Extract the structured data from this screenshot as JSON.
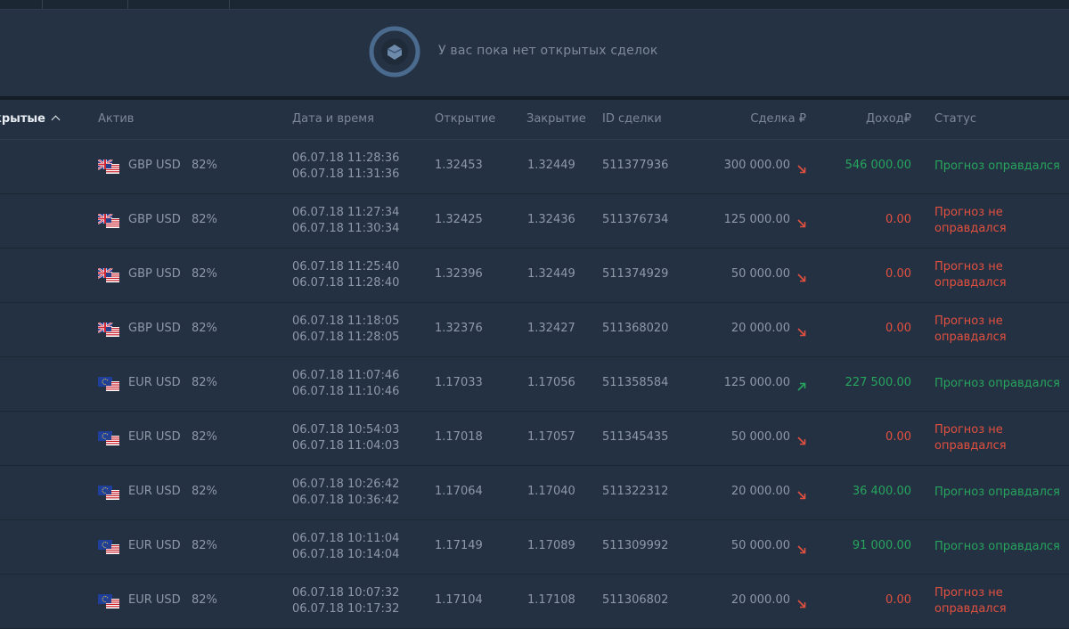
{
  "empty_message": "У вас пока нет открытых сделок",
  "colors": {
    "win": "#27a45d",
    "loss": "#e2503f",
    "background": "#243142"
  },
  "table": {
    "sort_label": "крытые",
    "headers": {
      "asset": "Актив",
      "datetime": "Дата и время",
      "open": "Открытие",
      "close": "Закрытие",
      "id": "ID сделки",
      "amount": "Сделка ₽",
      "income": "Доход₽",
      "status": "Статус"
    },
    "rows": [
      {
        "flag": "gb-us-flag-icon",
        "asset": "GBP USD",
        "pct": "82%",
        "dt_open": "06.07.18 11:28:36",
        "dt_close": "06.07.18 11:31:36",
        "open": "1.32453",
        "close": "1.32449",
        "id": "511377936",
        "amount": "300 000.00",
        "direction": "down",
        "income": "546 000.00",
        "status_line1": "Прогноз оправдался",
        "status_line2": "",
        "result": "win"
      },
      {
        "flag": "gb-us-flag-icon",
        "asset": "GBP USD",
        "pct": "82%",
        "dt_open": "06.07.18 11:27:34",
        "dt_close": "06.07.18 11:30:34",
        "open": "1.32425",
        "close": "1.32436",
        "id": "511376734",
        "amount": "125 000.00",
        "direction": "down",
        "income": "0.00",
        "status_line1": "Прогноз не",
        "status_line2": "оправдался",
        "result": "loss"
      },
      {
        "flag": "gb-us-flag-icon",
        "asset": "GBP USD",
        "pct": "82%",
        "dt_open": "06.07.18 11:25:40",
        "dt_close": "06.07.18 11:28:40",
        "open": "1.32396",
        "close": "1.32449",
        "id": "511374929",
        "amount": "50 000.00",
        "direction": "down",
        "income": "0.00",
        "status_line1": "Прогноз не",
        "status_line2": "оправдался",
        "result": "loss"
      },
      {
        "flag": "gb-us-flag-icon",
        "asset": "GBP USD",
        "pct": "82%",
        "dt_open": "06.07.18 11:18:05",
        "dt_close": "06.07.18 11:28:05",
        "open": "1.32376",
        "close": "1.32427",
        "id": "511368020",
        "amount": "20 000.00",
        "direction": "down",
        "income": "0.00",
        "status_line1": "Прогноз не",
        "status_line2": "оправдался",
        "result": "loss"
      },
      {
        "flag": "eu-us-flag-icon",
        "asset": "EUR USD",
        "pct": "82%",
        "dt_open": "06.07.18 11:07:46",
        "dt_close": "06.07.18 11:10:46",
        "open": "1.17033",
        "close": "1.17056",
        "id": "511358584",
        "amount": "125 000.00",
        "direction": "up",
        "income": "227 500.00",
        "status_line1": "Прогноз оправдался",
        "status_line2": "",
        "result": "win"
      },
      {
        "flag": "eu-us-flag-icon",
        "asset": "EUR USD",
        "pct": "82%",
        "dt_open": "06.07.18 10:54:03",
        "dt_close": "06.07.18 11:04:03",
        "open": "1.17018",
        "close": "1.17057",
        "id": "511345435",
        "amount": "50 000.00",
        "direction": "down",
        "income": "0.00",
        "status_line1": "Прогноз не",
        "status_line2": "оправдался",
        "result": "loss"
      },
      {
        "flag": "eu-us-flag-icon",
        "asset": "EUR USD",
        "pct": "82%",
        "dt_open": "06.07.18 10:26:42",
        "dt_close": "06.07.18 10:36:42",
        "open": "1.17064",
        "close": "1.17040",
        "id": "511322312",
        "amount": "20 000.00",
        "direction": "down",
        "income": "36 400.00",
        "status_line1": "Прогноз оправдался",
        "status_line2": "",
        "result": "win"
      },
      {
        "flag": "eu-us-flag-icon",
        "asset": "EUR USD",
        "pct": "82%",
        "dt_open": "06.07.18 10:11:04",
        "dt_close": "06.07.18 10:14:04",
        "open": "1.17149",
        "close": "1.17089",
        "id": "511309992",
        "amount": "50 000.00",
        "direction": "down",
        "income": "91 000.00",
        "status_line1": "Прогноз оправдался",
        "status_line2": "",
        "result": "win"
      },
      {
        "flag": "eu-us-flag-icon",
        "asset": "EUR USD",
        "pct": "82%",
        "dt_open": "06.07.18 10:07:32",
        "dt_close": "06.07.18 10:17:32",
        "open": "1.17104",
        "close": "1.17108",
        "id": "511306802",
        "amount": "20 000.00",
        "direction": "down",
        "income": "0.00",
        "status_line1": "Прогноз не",
        "status_line2": "оправдался",
        "result": "loss"
      }
    ]
  }
}
